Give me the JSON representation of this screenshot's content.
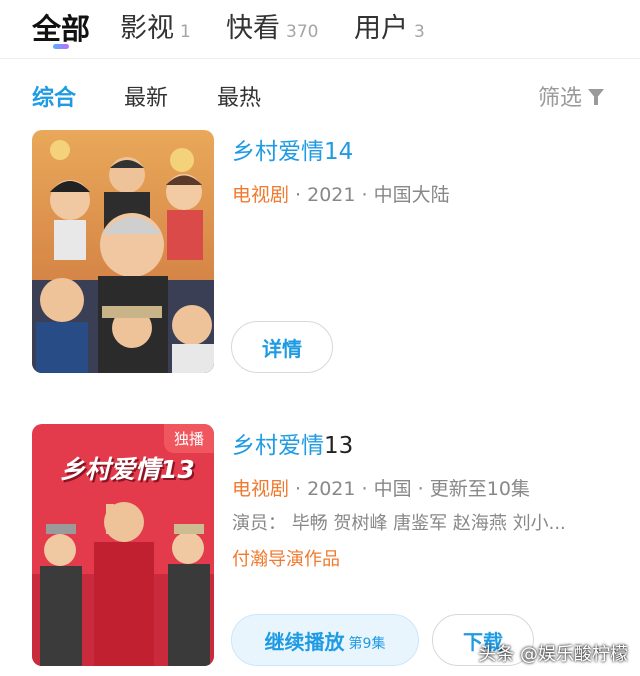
{
  "top_tabs": [
    {
      "label": "全部",
      "count": ""
    },
    {
      "label": "影视",
      "count": "1"
    },
    {
      "label": "快看",
      "count": "370"
    },
    {
      "label": "用户",
      "count": "3"
    }
  ],
  "sub_tabs": [
    "综合",
    "最新",
    "最热"
  ],
  "filter_label": "筛选",
  "results": [
    {
      "title": "乡村爱情14",
      "title_tail": "",
      "genre": "电视剧",
      "meta_rest": " · 2021 · 中国大陆",
      "button": "详情"
    },
    {
      "badge": "独播",
      "poster_text": "乡村爱情13",
      "title": "乡村爱情",
      "title_tail": "13",
      "genre": "电视剧",
      "meta_rest": " · 2021 · 中国 · 更新至10集",
      "cast": "演员：  毕畅  贺树峰  唐鉴军  赵海燕  刘小...",
      "director": "付瀚导演作品",
      "play_button": "继续播放",
      "play_episode": "第9集",
      "download_button": "下载"
    }
  ],
  "watermark": "头条 @娱乐酸柠檬",
  "colors": {
    "accent": "#1f9be3",
    "genre": "#f07a2f",
    "badge": "#f0565d"
  }
}
